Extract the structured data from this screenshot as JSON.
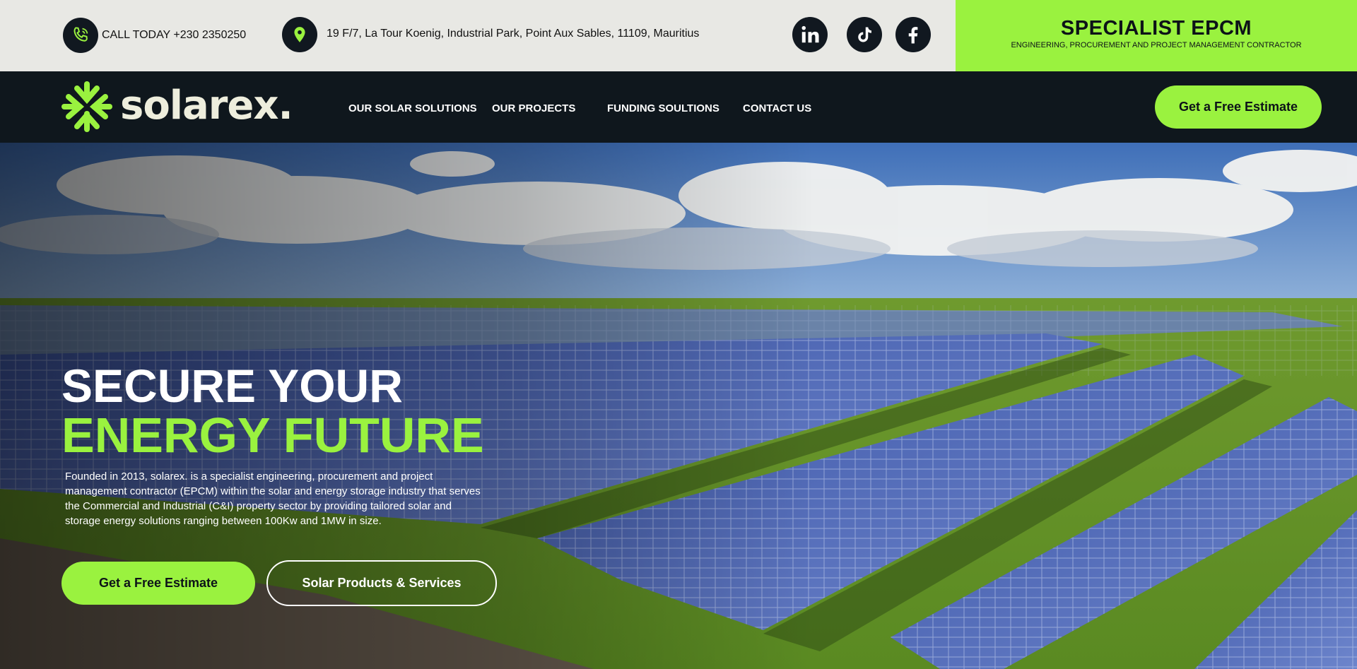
{
  "topbar": {
    "phone_text": "CALL TODAY +230 2350250",
    "address_text": "19 F/7, La Tour Koenig, Industrial Park, Point Aux Sables,  11109, Mauritius",
    "social": [
      "linkedin-icon",
      "tiktok-icon",
      "facebook-icon"
    ],
    "epcm_title": "SPECIALIST EPCM",
    "epcm_subtitle": "ENGINEERING, PROCUREMENT AND PROJECT MANAGEMENT CONTRACTOR"
  },
  "nav": {
    "logo_text": "solarex.",
    "items": [
      {
        "label": "OUR SOLAR SOLUTIONS"
      },
      {
        "label": "OUR PROJECTS"
      },
      {
        "label": "FUNDING SOULTIONS"
      },
      {
        "label": "CONTACT US"
      }
    ],
    "cta_label": "Get a Free Estimate"
  },
  "hero": {
    "headline_line1": "SECURE YOUR",
    "headline_line2": "ENERGY FUTURE",
    "description": "Founded in 2013, solarex. is a specialist engineering, procurement and project management contractor (EPCM) within the solar and energy storage industry that serves the Commercial and Industrial (C&I) property sector by providing tailored solar and storage energy solutions ranging between 100Kw and 1MW in size.",
    "primary_cta": "Get a Free Estimate",
    "secondary_cta": "Solar Products & Services"
  },
  "colors": {
    "accent": "#9af23f",
    "dark": "#0f171d",
    "topbar_bg": "#e8e8e4"
  }
}
